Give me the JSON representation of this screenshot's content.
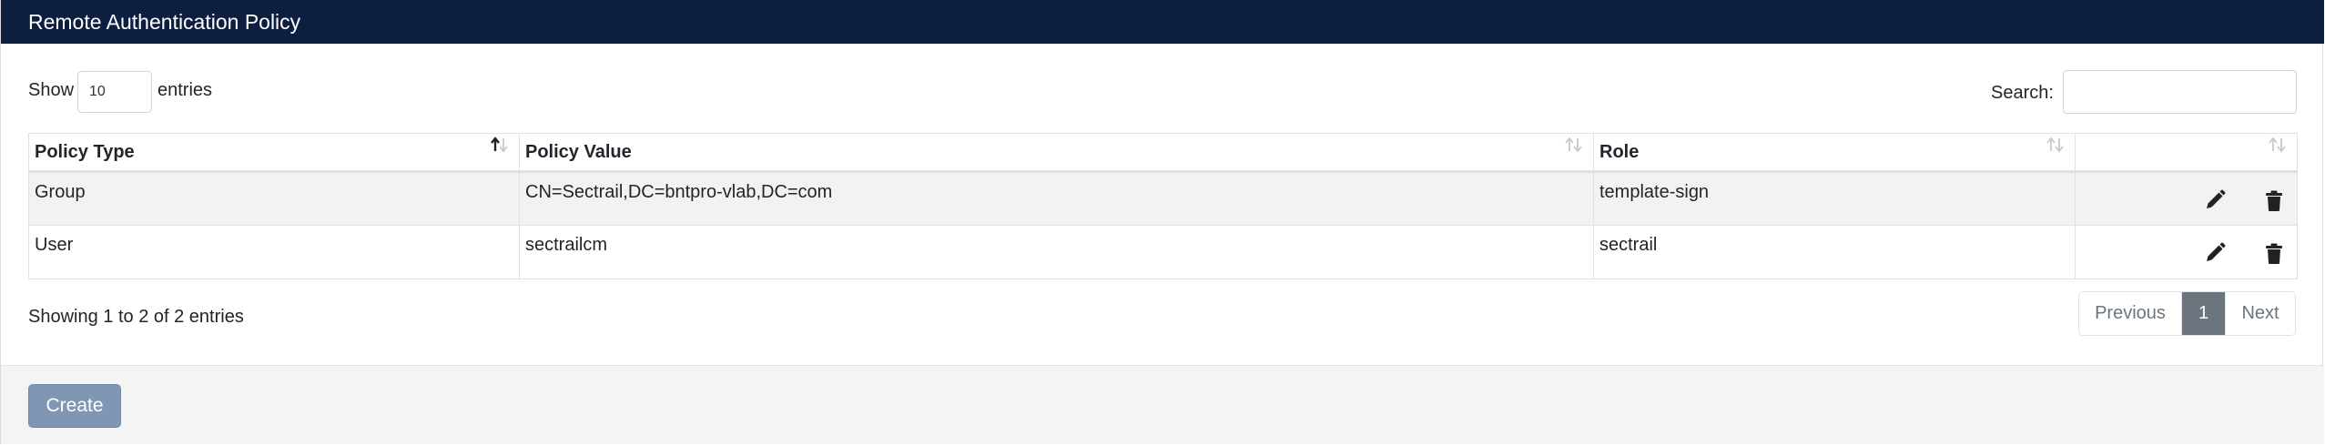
{
  "header": {
    "title": "Remote Authentication Policy"
  },
  "length_control": {
    "show_label": "Show",
    "value": "10",
    "entries_label": "entries"
  },
  "search": {
    "label": "Search:",
    "value": ""
  },
  "table": {
    "columns": [
      "Policy Type",
      "Policy Value",
      "Role",
      ""
    ],
    "sort": {
      "column": "Policy Type",
      "direction": "ascending"
    },
    "rows": [
      {
        "policy_type": "Group",
        "policy_value": "CN=Sectrail,DC=bntpro-vlab,DC=com",
        "role": "template-sign"
      },
      {
        "policy_type": "User",
        "policy_value": "sectrailcm",
        "role": "sectrail"
      }
    ],
    "row_actions": {
      "edit_icon": "pencil-icon",
      "delete_icon": "trash-icon"
    }
  },
  "info": {
    "text": "Showing 1 to 2 of 2 entries"
  },
  "pagination": {
    "previous": "Previous",
    "current": "1",
    "next": "Next"
  },
  "footer": {
    "create_label": "Create"
  },
  "colors": {
    "header_bg": "#0d1f40",
    "create_btn": "#7f97b2",
    "active_page": "#6c757d"
  }
}
